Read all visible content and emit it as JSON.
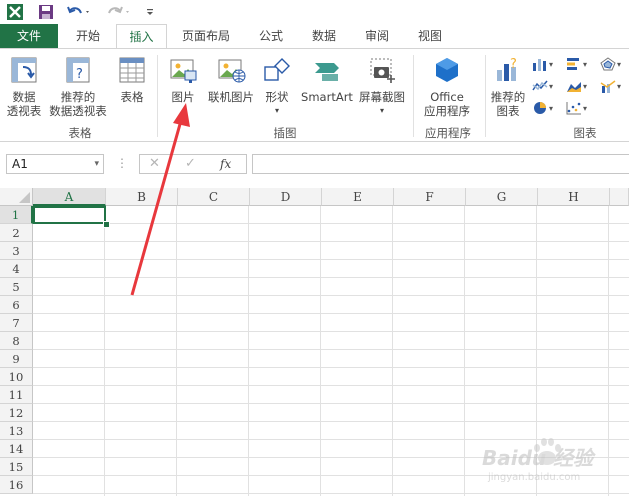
{
  "tabs": {
    "file": "文件",
    "home": "开始",
    "insert": "插入",
    "page_layout": "页面布局",
    "formulas": "公式",
    "data": "数据",
    "review": "审阅",
    "view": "视图"
  },
  "ribbon": {
    "tables": {
      "pivot_table": [
        "数据",
        "透视表"
      ],
      "recommended_pivot": [
        "推荐的",
        "数据透视表"
      ],
      "table": "表格",
      "group_label": "表格"
    },
    "illustrations": {
      "pictures": "图片",
      "online_pictures": "联机图片",
      "shapes": "形状",
      "smartart": "SmartArt",
      "screenshot": "屏幕截图",
      "group_label": "插图"
    },
    "apps": {
      "office": [
        "Office",
        "应用程序"
      ],
      "group_label": "应用程序"
    },
    "charts": {
      "recommended_charts": [
        "推荐的",
        "图表"
      ],
      "group_label": "图表"
    }
  },
  "formula_bar": {
    "name_box": "A1",
    "fx_label": "fx",
    "formula": ""
  },
  "sheet": {
    "columns": [
      "A",
      "B",
      "C",
      "D",
      "E",
      "F",
      "G",
      "H"
    ],
    "rows": [
      "1",
      "2",
      "3",
      "4",
      "5",
      "6",
      "7",
      "8",
      "9",
      "10",
      "11",
      "12",
      "13",
      "14",
      "15",
      "16"
    ],
    "selected_cell": "A1"
  },
  "watermark": {
    "text": "Baidu 经验",
    "sub": "jingyan.baidu.com"
  },
  "colors": {
    "accent": "#217346",
    "annotation_arrow": "#e8383d"
  }
}
